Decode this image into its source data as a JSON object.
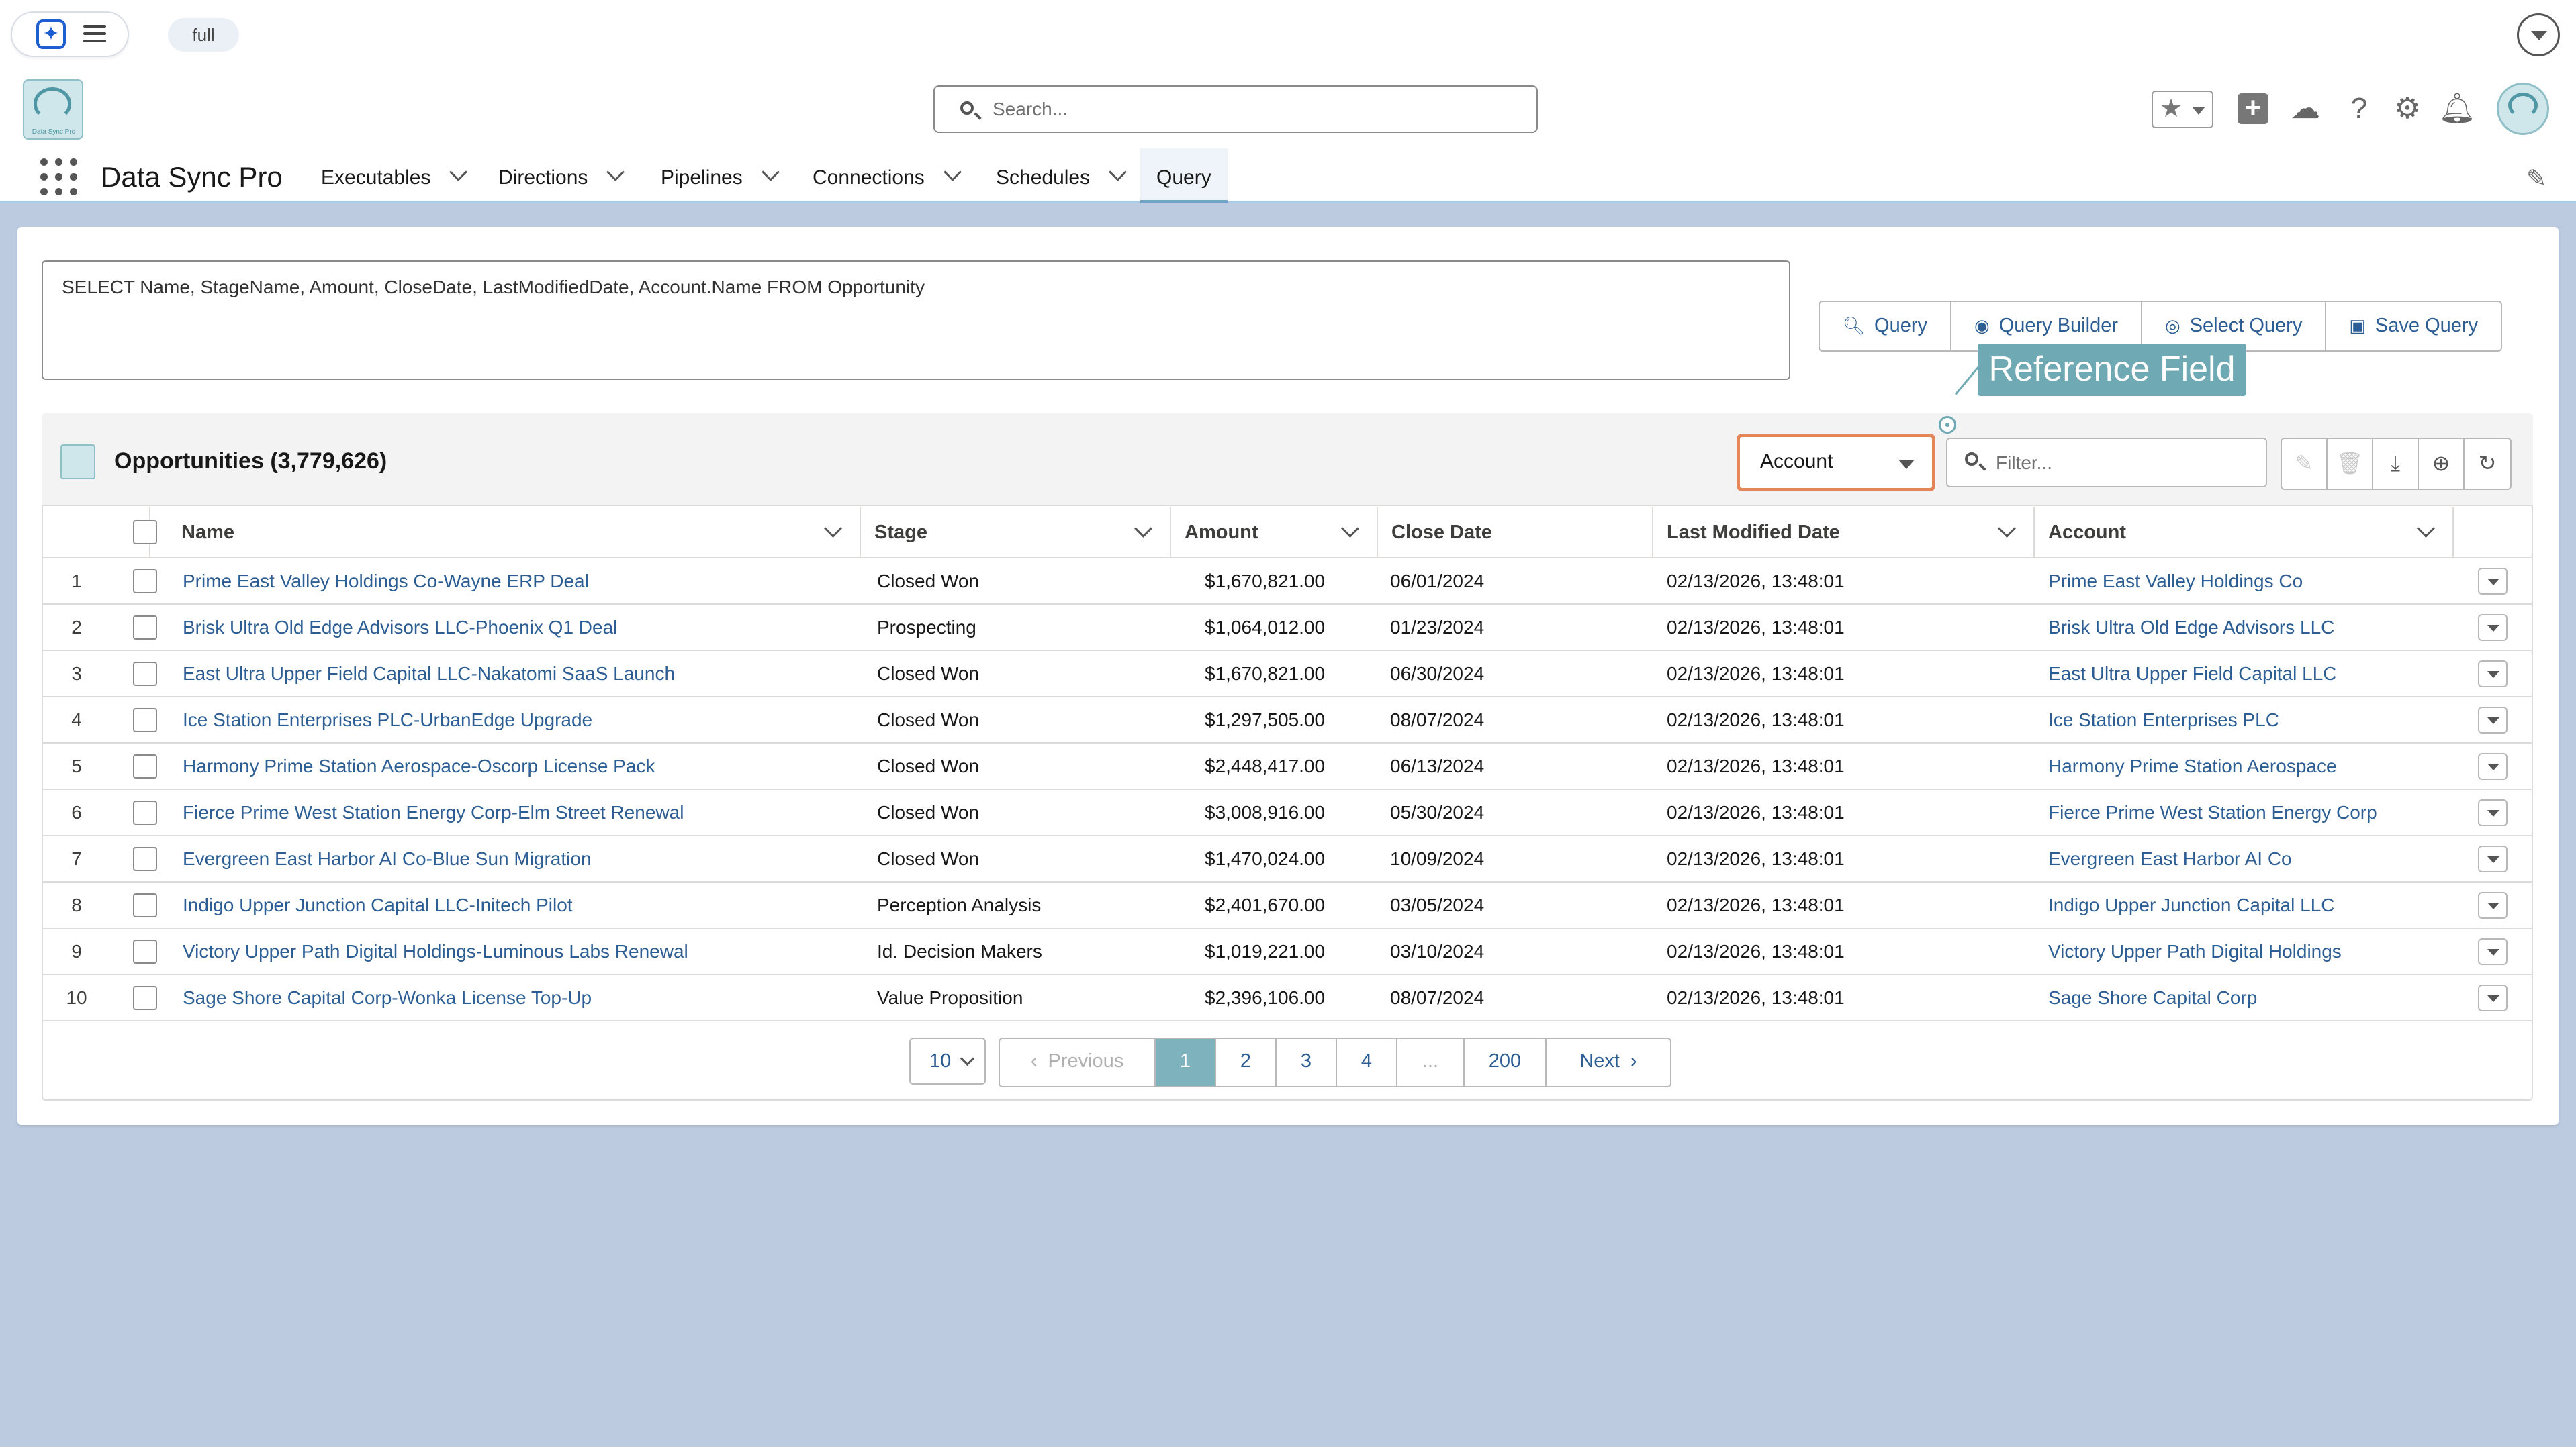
{
  "topbar": {
    "env_label": "full"
  },
  "header": {
    "logo_text": "Data Sync Pro",
    "search_placeholder": "Search...",
    "app_name": "Data Sync Pro",
    "nav": [
      {
        "label": "Executables"
      },
      {
        "label": "Directions"
      },
      {
        "label": "Pipelines"
      },
      {
        "label": "Connections"
      },
      {
        "label": "Schedules"
      },
      {
        "label": "Query"
      }
    ],
    "active_nav": "Query"
  },
  "query": {
    "soql": "SELECT Name, StageName, Amount, CloseDate, LastModifiedDate, Account.Name FROM Opportunity",
    "buttons": {
      "query": "Query",
      "query_builder": "Query Builder",
      "select_query": "Select Query",
      "save_query": "Save Query"
    }
  },
  "callout": {
    "label": "Reference Field"
  },
  "results": {
    "title": "Opportunities (3,779,626)",
    "reference_field_value": "Account",
    "filter_placeholder": "Filter...",
    "columns": [
      "Name",
      "Stage",
      "Amount",
      "Close Date",
      "Last Modified Date",
      "Account"
    ],
    "rows": [
      {
        "n": "1",
        "name": "Prime East Valley Holdings Co-Wayne ERP Deal",
        "stage": "Closed Won",
        "amount": "$1,670,821.00",
        "close": "06/01/2024",
        "modified": "02/13/2026, 13:48:01",
        "account": "Prime East Valley Holdings Co"
      },
      {
        "n": "2",
        "name": "Brisk Ultra Old Edge Advisors LLC-Phoenix Q1 Deal",
        "stage": "Prospecting",
        "amount": "$1,064,012.00",
        "close": "01/23/2024",
        "modified": "02/13/2026, 13:48:01",
        "account": "Brisk Ultra Old Edge Advisors LLC"
      },
      {
        "n": "3",
        "name": "East Ultra Upper Field Capital LLC-Nakatomi SaaS Launch",
        "stage": "Closed Won",
        "amount": "$1,670,821.00",
        "close": "06/30/2024",
        "modified": "02/13/2026, 13:48:01",
        "account": "East Ultra Upper Field Capital LLC"
      },
      {
        "n": "4",
        "name": "Ice Station Enterprises PLC-UrbanEdge Upgrade",
        "stage": "Closed Won",
        "amount": "$1,297,505.00",
        "close": "08/07/2024",
        "modified": "02/13/2026, 13:48:01",
        "account": "Ice Station Enterprises PLC"
      },
      {
        "n": "5",
        "name": "Harmony Prime Station Aerospace-Oscorp License Pack",
        "stage": "Closed Won",
        "amount": "$2,448,417.00",
        "close": "06/13/2024",
        "modified": "02/13/2026, 13:48:01",
        "account": "Harmony Prime Station Aerospace"
      },
      {
        "n": "6",
        "name": "Fierce Prime West Station Energy Corp-Elm Street Renewal",
        "stage": "Closed Won",
        "amount": "$3,008,916.00",
        "close": "05/30/2024",
        "modified": "02/13/2026, 13:48:01",
        "account": "Fierce Prime West Station Energy Corp"
      },
      {
        "n": "7",
        "name": "Evergreen East Harbor AI Co-Blue Sun Migration",
        "stage": "Closed Won",
        "amount": "$1,470,024.00",
        "close": "10/09/2024",
        "modified": "02/13/2026, 13:48:01",
        "account": "Evergreen East Harbor AI Co"
      },
      {
        "n": "8",
        "name": "Indigo Upper Junction Capital LLC-Initech Pilot",
        "stage": "Perception Analysis",
        "amount": "$2,401,670.00",
        "close": "03/05/2024",
        "modified": "02/13/2026, 13:48:01",
        "account": "Indigo Upper Junction Capital LLC"
      },
      {
        "n": "9",
        "name": "Victory Upper Path Digital Holdings-Luminous Labs Renewal",
        "stage": "Id. Decision Makers",
        "amount": "$1,019,221.00",
        "close": "03/10/2024",
        "modified": "02/13/2026, 13:48:01",
        "account": "Victory Upper Path Digital Holdings"
      },
      {
        "n": "10",
        "name": "Sage Shore Capital Corp-Wonka License Top-Up",
        "stage": "Value Proposition",
        "amount": "$2,396,106.00",
        "close": "08/07/2024",
        "modified": "02/13/2026, 13:48:01",
        "account": "Sage Shore Capital Corp"
      }
    ]
  },
  "pagination": {
    "page_size": "10",
    "previous": "Previous",
    "pages": [
      "1",
      "2",
      "3",
      "4",
      "...",
      "200"
    ],
    "current": "1",
    "next": "Next"
  },
  "colors": {
    "accent": "#7eb3bd",
    "link": "#2c5e94",
    "background": "#bccbe0",
    "highlight": "#e3865a"
  }
}
